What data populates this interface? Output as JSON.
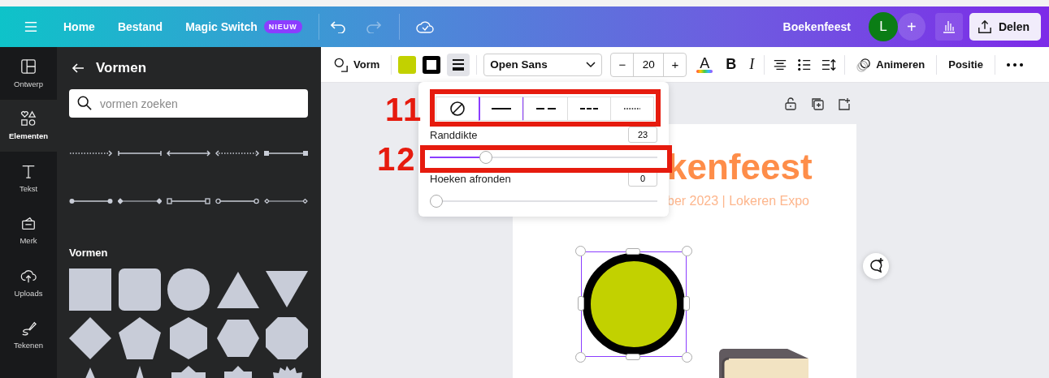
{
  "header": {
    "nav": [
      "Home",
      "Bestand",
      "Magic Switch"
    ],
    "new_badge": "NIEUW",
    "redo_disabled": true,
    "document_title": "Boekenfeest",
    "avatar": {
      "initial": "L"
    },
    "add_label": "+",
    "share_label": "Delen"
  },
  "rail": [
    {
      "label": "Ontwerp",
      "kind": "layout",
      "selected": false
    },
    {
      "label": "Elementen",
      "kind": "elements",
      "selected": true
    },
    {
      "label": "Tekst",
      "kind": "text",
      "selected": false
    },
    {
      "label": "Merk",
      "kind": "brand",
      "selected": false
    },
    {
      "label": "Uploads",
      "kind": "upload",
      "selected": false
    },
    {
      "label": "Tekenen",
      "kind": "draw",
      "selected": false
    }
  ],
  "panel": {
    "title": "Vormen",
    "search": {
      "placeholder": "vormen zoeken"
    },
    "section_title": "Vormen"
  },
  "toolbar": {
    "shape_label": "Vorm",
    "border_style_active": true,
    "font": "Open Sans",
    "minus": "−",
    "font_size": "20",
    "plus": "+",
    "text_color_letter": "A",
    "bold": "B",
    "italic": "I",
    "animate": "Animeren",
    "position": "Positie"
  },
  "border_popup": {
    "line_styles": [
      {
        "kind": "none",
        "selected": false
      },
      {
        "kind": "solid",
        "selected": true
      },
      {
        "kind": "long-dash",
        "selected": false
      },
      {
        "kind": "dash",
        "selected": false
      },
      {
        "kind": "dot",
        "selected": false
      }
    ],
    "sliders": [
      {
        "label": "Randdikte",
        "value": "23",
        "level": 0.23
      },
      {
        "label": "Hoeken afronden",
        "value": "0",
        "level": 0
      }
    ]
  },
  "annotations": [
    {
      "number": "11"
    },
    {
      "number": "12"
    }
  ],
  "canvas": {
    "title": "kenfeest",
    "subtitle": "ber 2023 | Lokeren Expo"
  }
}
